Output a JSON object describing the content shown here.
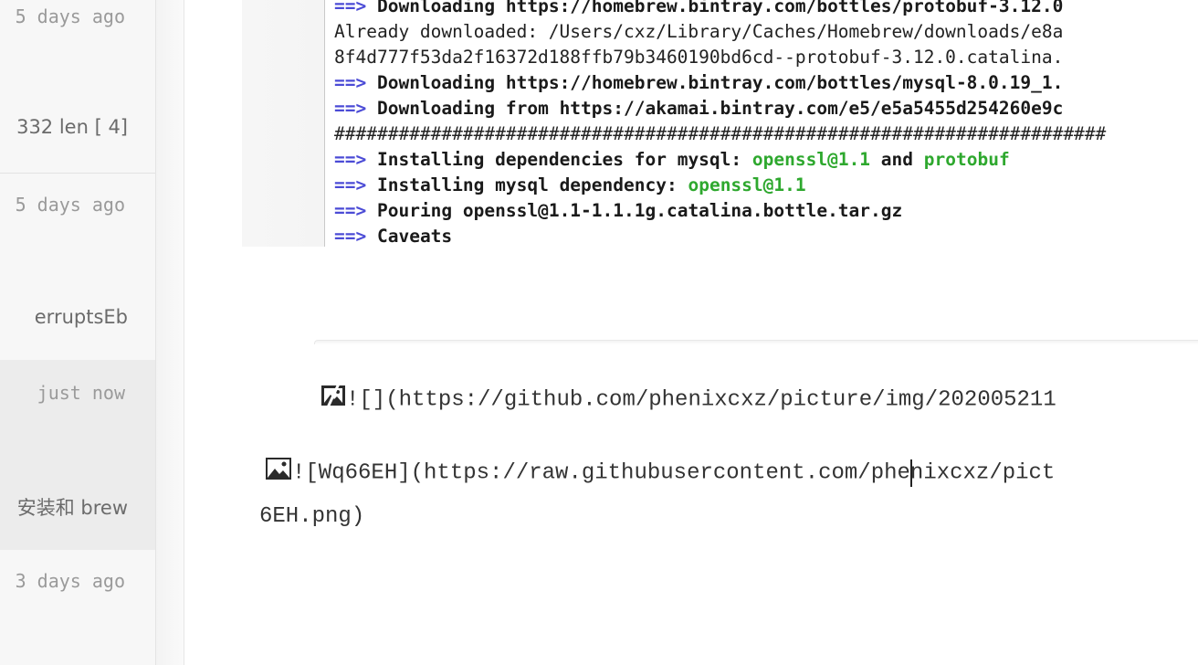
{
  "sidebar": {
    "items": [
      {
        "date": "5 days ago"
      },
      {
        "excerpt": "332 len [ 4]"
      },
      {
        "date": "5 days ago"
      },
      {
        "excerpt": "erruptsEb"
      },
      {
        "date": "just now",
        "selected": true
      },
      {
        "excerpt": "安装和 brew"
      },
      {
        "date": "3 days ago"
      }
    ]
  },
  "terminal": {
    "lines": [
      {
        "arrow": "==>",
        "text": "Downloading https://homebrew.bintray.com/bottles/protobuf-3.12.0"
      },
      {
        "text": "Already downloaded: /Users/cxz/Library/Caches/Homebrew/downloads/e8a"
      },
      {
        "text": "8f4d777f53da2f16372d188ffb79b3460190bd6cd--protobuf-3.12.0.catalina."
      },
      {
        "arrow": "==>",
        "text": "Downloading https://homebrew.bintray.com/bottles/mysql-8.0.19_1."
      },
      {
        "arrow": "==>",
        "text": "Downloading from https://akamai.bintray.com/e5/e5a5455d254260e9c"
      },
      {
        "text": "########################################################################"
      },
      {
        "arrow": "==>",
        "text": "Installing dependencies for mysql:",
        "green1": "openssl@1.1",
        "mid": "and",
        "green2": "protobuf"
      },
      {
        "arrow": "==>",
        "text": "Installing mysql dependency:",
        "green1": "openssl@1.1"
      },
      {
        "arrow": "==>",
        "text": "Pouring openssl@1.1-1.1.1g.catalina.bottle.tar.gz"
      },
      {
        "arrow": "==>",
        "text": "Caveats"
      }
    ]
  },
  "editor": {
    "line1": "![](https://github.com/phenixcxz/picture/img/202005211",
    "line2": "![Wq66EH](https://raw.githubusercontent.com/phenixcxz/pict",
    "line2_cont": "6EH.png)"
  },
  "colors": {
    "arrow": "#4b4bd6",
    "green": "#2ea82e",
    "sidebar_bg": "#f7f7f7",
    "selected_bg": "#ececec"
  },
  "icons": {
    "broken_image": "broken-image-icon",
    "image": "image-icon"
  }
}
